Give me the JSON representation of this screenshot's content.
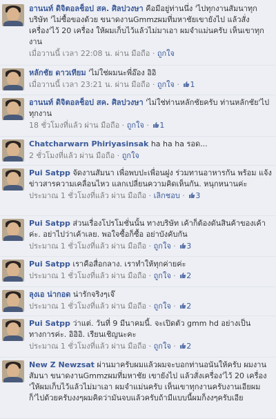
{
  "comments": [
    {
      "author": "อานนท์ ดิจิตอลช็อป สค. ศิลปวงษา",
      "text": " คือมีอยู่ท่านนึ่ง 'ไปทุกงานสัมนาทุกบริษัท 'ไม่ซื้อของด้วย ขนาดงานGmmzผมที่มหาชัยเขายังไป แล้วสั่งเครื่อง'ไว้ 20 เครื่อง ให้ผมเก็บไว้แล้วไม่มาเอา ผมจำแม่นครับ เห็นเขาทุกงาน",
      "time": "เมื่อวานนี้ เวลา 22:08 น. ผ่าน มือถือ",
      "like_label": "ถูกใจ",
      "unlike_label": "",
      "likes": ""
    },
    {
      "author": "หลักชัย ดาวเทียม",
      "text": " 'ไม่ใช่ผมนะพี่อ๊อง อิอิ",
      "time": "เมื่อวานนี้ เวลา 23:21 น. ผ่าน มือถือ",
      "like_label": "ถูกใจ",
      "unlike_label": "",
      "likes": "1"
    },
    {
      "author": "อานนท์ ดิจิตอลช็อป สค. ศิลปวงษา",
      "text": " 'ไม่ใช่ท่านหลักชัยครับ ท่านหลักชัย'ไปทุกงาน",
      "time": "18 ชั่วโมงที่แล้ว ผ่าน มือถือ",
      "like_label": "ถูกใจ",
      "unlike_label": "",
      "likes": "1"
    },
    {
      "author": "Chatcharwarn Phiriyasinsak",
      "text": " ha ha ha รอด...",
      "time": "2 ชั่วโมงที่แล้ว ผ่าน มือถือ",
      "like_label": "ถูกใจ",
      "unlike_label": "",
      "likes": ""
    },
    {
      "author": "Pui Satpp",
      "text": " จัดงานสัมนา เพื่อพบปะเพื่อนฝูง ร่วมทานอาหารกัน พร้อม แจ้งข่าวสารความเคลื่อนไหว แลกเปลี่ยนความคิดเห็นกัน. หนุกหนานค่ะ",
      "time": "ประมาณ 1 ชั่วโมงที่แล้ว ผ่าน มือถือ",
      "like_label": "",
      "unlike_label": "เลิกชอบ",
      "likes": "3"
    },
    {
      "author": "Pui Satpp",
      "text": " ส่วนเรื่องโปรโมชั่นนั้น ทางบริษัท เค้าก็ต้องดันสินค้าของเค้าค่ะ. อย่าไปว่าเค้าเลย. พอใจซื้อก็ซื้อ อย่าบังคับกัน",
      "time": "ประมาณ 1 ชั่วโมงที่แล้ว ผ่าน มือถือ",
      "like_label": "ถูกใจ",
      "unlike_label": "",
      "likes": "3"
    },
    {
      "author": "Pui Satpp",
      "text": " เราคือสื่อกลาง. เราทำให้ทุกค่ายค่ะ",
      "time": "ประมาณ 1 ชั่วโมงที่แล้ว ผ่าน มือถือ",
      "like_label": "ถูกใจ",
      "unlike_label": "",
      "likes": "2"
    },
    {
      "author": "ลุงเอ น่ากอด",
      "text": " น่ารักจริงๆเจ๊",
      "time": "ประมาณ 1 ชั่วโมงที่แล้ว ผ่าน มือถือ",
      "like_label": "ถูกใจ",
      "unlike_label": "",
      "likes": "2"
    },
    {
      "author": "Pui Satpp",
      "text": " ว่าแต่. วันที่ 9 มีนาคมนี้. จะเปิดตัว gmm hd อย่างเป็นทางการค่ะ. อิอิอิ. เรียนเชิญนะคะ",
      "time": "ประมาณ 1 ชั่วโมงที่แล้ว ผ่าน มือถือ",
      "like_label": "ถูกใจ",
      "unlike_label": "",
      "likes": "2"
    },
    {
      "author": "New Z Newzsat",
      "text": " ผ่านมาครับผมแล้วผมจะบอกท่านอนันให้ครับ ผมงานสัมนา ขนาดงานGmmzผมที่มหาชัย เขายังไป แล้วสั่งเครื่อง'ไว้ 20 เครื่อง 'ให้ผมเก็บไว้แล้วไม่มาเอา ผมจำแม่นครับ เห็นเขาทุกงานครับงานเอียผมก็'ไปด้วยครับงงๆผมคิดว่ามันจบแล้วครับถ้ามีแบบนี้ผมก็งงๆครับเอีย",
      "time": "",
      "like_label": "",
      "unlike_label": "",
      "likes": ""
    }
  ],
  "ui": {
    "separator": " · ",
    "like_icon": "thumbs-up-icon",
    "link_color": "#3b5998",
    "meta_color": "#808080",
    "background": "#edeff4"
  }
}
